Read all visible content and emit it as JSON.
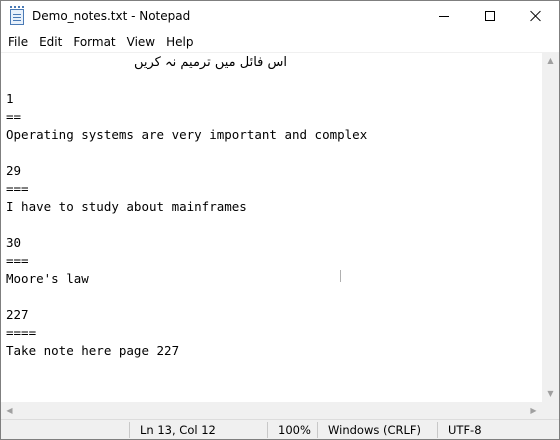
{
  "window": {
    "title": "Demo_notes.txt - Notepad"
  },
  "menu": [
    "File",
    "Edit",
    "Format",
    "View",
    "Help"
  ],
  "editor": {
    "urdu_line": "اس فائل میں ترمیم نہ کریں",
    "lines": [
      "1",
      "==",
      "Operating systems are very important and complex",
      "",
      "29",
      "===",
      "I have to study about mainframes",
      "",
      "30",
      "===",
      "Moore's law",
      "",
      "227",
      "====",
      "Take note here page 227"
    ]
  },
  "status": {
    "position": "Ln 13, Col 12",
    "zoom": "100%",
    "line_ending": "Windows (CRLF)",
    "encoding": "UTF-8"
  },
  "icons": {
    "app": "notepad-icon",
    "minimize": "minimize-icon",
    "maximize": "maximize-icon",
    "close": "close-icon"
  }
}
